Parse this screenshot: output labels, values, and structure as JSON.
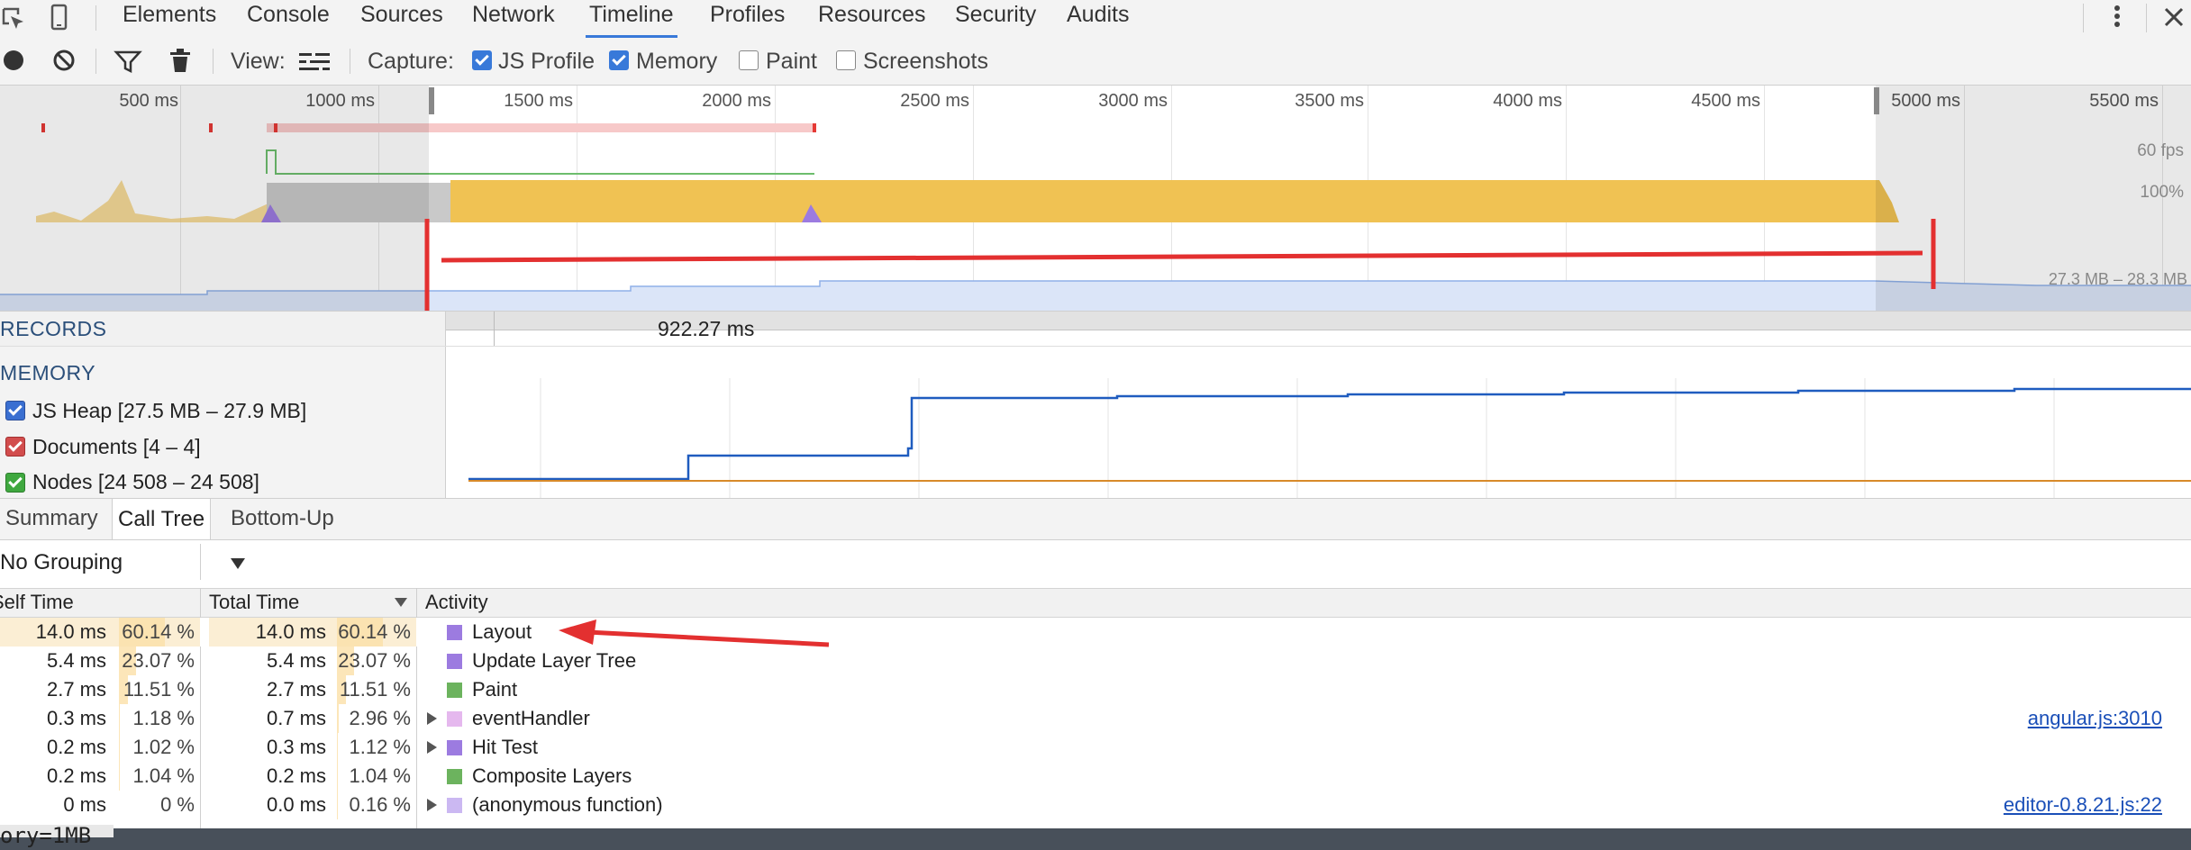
{
  "tabs": [
    "Elements",
    "Console",
    "Sources",
    "Network",
    "Timeline",
    "Profiles",
    "Resources",
    "Security",
    "Audits"
  ],
  "selected_tab": "Timeline",
  "toolbar": {
    "view_label": "View:",
    "capture_label": "Capture:",
    "js_profile": "JS Profile",
    "memory": "Memory",
    "paint": "Paint",
    "screenshots": "Screenshots",
    "js_profile_checked": true,
    "memory_checked": true,
    "paint_checked": false,
    "screenshots_checked": false
  },
  "overview": {
    "ticks": [
      "500 ms",
      "1000 ms",
      "1500 ms",
      "2000 ms",
      "2500 ms",
      "3000 ms",
      "3500 ms",
      "4000 ms",
      "4500 ms",
      "5000 ms",
      "5500 ms"
    ],
    "fps_label": "60 fps",
    "cpu_label": "100%",
    "memory_range": "27.3 MB – 28.3 MB"
  },
  "records": {
    "title": "RECORDS",
    "duration": "922.27 ms"
  },
  "memory": {
    "title": "MEMORY",
    "counters": [
      {
        "label": "JS Heap [27.5 MB – 27.9 MB]",
        "color": "#3a6fd1"
      },
      {
        "label": "Documents [4 – 4]",
        "color": "#d24d4d"
      },
      {
        "label": "Nodes [24 508 – 24 508]",
        "color": "#3fa83f"
      }
    ]
  },
  "bottom": {
    "tabs": [
      "Summary",
      "Call Tree",
      "Bottom-Up"
    ],
    "selected": "Call Tree",
    "grouping": "No Grouping",
    "headers": {
      "self": "Self Time",
      "total": "Total Time",
      "activity": "Activity"
    },
    "rows": [
      {
        "self": "14.0 ms",
        "self_pct": "60.14 %",
        "total": "14.0 ms",
        "total_pct": "60.14 %",
        "name": "Layout",
        "color": "#9c7be0",
        "expand": false,
        "link": ""
      },
      {
        "self": "5.4 ms",
        "self_pct": "23.07 %",
        "total": "5.4 ms",
        "total_pct": "23.07 %",
        "name": "Update Layer Tree",
        "color": "#9c7be0",
        "expand": false,
        "link": ""
      },
      {
        "self": "2.7 ms",
        "self_pct": "11.51 %",
        "total": "2.7 ms",
        "total_pct": "11.51 %",
        "name": "Paint",
        "color": "#6cb35e",
        "expand": false,
        "link": ""
      },
      {
        "self": "0.3 ms",
        "self_pct": "1.18 %",
        "total": "0.7 ms",
        "total_pct": "2.96 %",
        "name": "eventHandler",
        "color": "#e5b8ee",
        "expand": true,
        "link": "angular.js:3010"
      },
      {
        "self": "0.2 ms",
        "self_pct": "1.02 %",
        "total": "0.3 ms",
        "total_pct": "1.12 %",
        "name": "Hit Test",
        "color": "#9c7be0",
        "expand": true,
        "link": ""
      },
      {
        "self": "0.2 ms",
        "self_pct": "1.04 %",
        "total": "0.2 ms",
        "total_pct": "1.04 %",
        "name": "Composite Layers",
        "color": "#6cb35e",
        "expand": false,
        "link": ""
      },
      {
        "self": "0 ms",
        "self_pct": "0 %",
        "total": "0.0 ms",
        "total_pct": "0.16 %",
        "name": "(anonymous function)",
        "color": "#cbb8f2",
        "expand": true,
        "link": "editor-0.8.21.js:22"
      }
    ]
  },
  "footer_text": "ory=1MB",
  "colors": {
    "accent": "#3879d9",
    "scripting": "#f0c253",
    "heap_line": "#1f5cbf",
    "annotation": "#e33030"
  }
}
